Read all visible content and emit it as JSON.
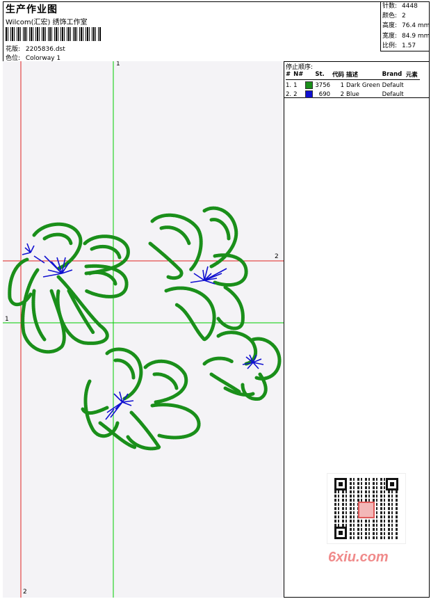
{
  "header": {
    "title": "生产作业图",
    "company": "Wilcom(汇宏) 绣饰工作室",
    "design_label": "花版:",
    "design_value": "2205836.dst",
    "colorway_label": "色位:",
    "colorway_value": "Colorway 1"
  },
  "stats": [
    {
      "label": "针数:",
      "value": "4448"
    },
    {
      "label": "颜色:",
      "value": "2"
    },
    {
      "label": "高度:",
      "value": "76.4 mm"
    },
    {
      "label": "宽度:",
      "value": "84.9 mm"
    },
    {
      "label": "比例:",
      "value": "1.57"
    }
  ],
  "stop_sequence": {
    "heading": "停止顺序:",
    "columns": [
      "#",
      "N#",
      "St.",
      "代码",
      "描述",
      "Brand",
      "元素"
    ],
    "rows": [
      {
        "index": "1.",
        "needle": "1",
        "color": "#1a8f1a",
        "stitches": "3756",
        "code": "1",
        "desc": "Dark Green",
        "brand": "Default",
        "element": ""
      },
      {
        "index": "2.",
        "needle": "2",
        "color": "#1010d0",
        "stitches": "690",
        "code": "2",
        "desc": "Blue",
        "brand": "Default",
        "element": ""
      }
    ]
  },
  "guides": {
    "v1_label": "1",
    "v2_label": "2",
    "h1_label": "1",
    "h2_label": "2",
    "v1_color": "#00cc00",
    "v2_color": "#e02020",
    "h1_color": "#00cc00",
    "h2_color": "#e02020"
  },
  "colors": {
    "thread_green": "#1a8f1a",
    "thread_blue": "#1010d0",
    "watermark": "#f08a8a"
  },
  "watermark": {
    "text": "6xiu.com",
    "seal_text": "设计图"
  }
}
